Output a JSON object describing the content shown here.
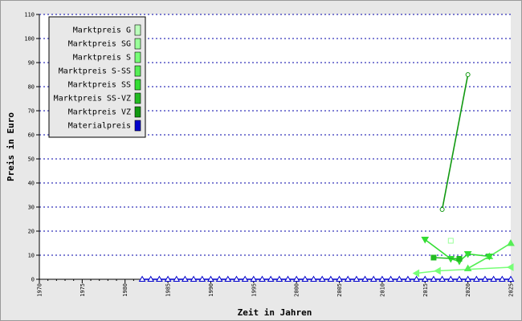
{
  "chart_data": {
    "type": "line",
    "title": "",
    "xlabel": "Zeit in Jahren",
    "ylabel": "Preis in Euro",
    "xlim": [
      1970,
      2025
    ],
    "ylim": [
      0,
      110
    ],
    "x_ticks": [
      1970,
      1975,
      1980,
      1985,
      1990,
      1995,
      2000,
      2005,
      2010,
      2015,
      2020,
      2025
    ],
    "y_ticks": [
      0,
      10,
      20,
      30,
      40,
      50,
      60,
      70,
      80,
      90,
      100,
      110
    ],
    "grid": "horizontal-dotted",
    "legend_position": "top-left",
    "series": [
      {
        "name": "Marktpreis G",
        "color": "#bbffbb",
        "marker": "none",
        "points": []
      },
      {
        "name": "Marktpreis SG",
        "color": "#99ff99",
        "marker": "square-open",
        "points": [
          [
            2018,
            16
          ]
        ]
      },
      {
        "name": "Marktpreis S",
        "color": "#77ff77",
        "marker": "triangle-left",
        "points": [
          [
            2014,
            2.5
          ],
          [
            2016.5,
            3.5
          ],
          [
            2025,
            5
          ]
        ]
      },
      {
        "name": "Marktpreis S-SS",
        "color": "#55ee55",
        "marker": "triangle-up",
        "points": [
          [
            2020,
            4.5
          ],
          [
            2022.5,
            9.5
          ],
          [
            2025,
            15
          ]
        ]
      },
      {
        "name": "Marktpreis SS",
        "color": "#33dd33",
        "marker": "triangle-down",
        "points": [
          [
            2015,
            16.5
          ],
          [
            2018,
            8.5
          ],
          [
            2019,
            7.5
          ],
          [
            2020,
            10.5
          ],
          [
            2022.5,
            9.5
          ]
        ]
      },
      {
        "name": "Marktpreis SS-VZ",
        "color": "#22bb22",
        "marker": "square",
        "points": [
          [
            2016,
            9
          ],
          [
            2019,
            8.5
          ]
        ]
      },
      {
        "name": "Marktpreis VZ",
        "color": "#119911",
        "marker": "circle-open",
        "points": [
          [
            2017,
            29
          ],
          [
            2020,
            85
          ]
        ]
      },
      {
        "name": "Materialpreis",
        "color": "#0000cc",
        "marker": "triangle-up-open",
        "points": [
          [
            1982,
            0
          ],
          [
            1983,
            0
          ],
          [
            1984,
            0
          ],
          [
            1985,
            0
          ],
          [
            1986,
            0
          ],
          [
            1987,
            0
          ],
          [
            1988,
            0
          ],
          [
            1989,
            0
          ],
          [
            1990,
            0
          ],
          [
            1991,
            0
          ],
          [
            1992,
            0
          ],
          [
            1993,
            0
          ],
          [
            1994,
            0
          ],
          [
            1995,
            0
          ],
          [
            1996,
            0
          ],
          [
            1997,
            0
          ],
          [
            1998,
            0
          ],
          [
            1999,
            0
          ],
          [
            2000,
            0
          ],
          [
            2001,
            0
          ],
          [
            2002,
            0
          ],
          [
            2003,
            0
          ],
          [
            2004,
            0
          ],
          [
            2005,
            0
          ],
          [
            2006,
            0
          ],
          [
            2007,
            0
          ],
          [
            2008,
            0
          ],
          [
            2009,
            0
          ],
          [
            2010,
            0
          ],
          [
            2011,
            0
          ],
          [
            2012,
            0
          ],
          [
            2013,
            0
          ],
          [
            2014,
            0
          ],
          [
            2015,
            0
          ],
          [
            2016,
            0
          ],
          [
            2017,
            0
          ],
          [
            2018,
            0
          ],
          [
            2019,
            0
          ],
          [
            2020,
            0
          ],
          [
            2021,
            0
          ],
          [
            2022,
            0
          ],
          [
            2023,
            0
          ],
          [
            2024,
            0
          ],
          [
            2025,
            0
          ]
        ]
      }
    ]
  }
}
